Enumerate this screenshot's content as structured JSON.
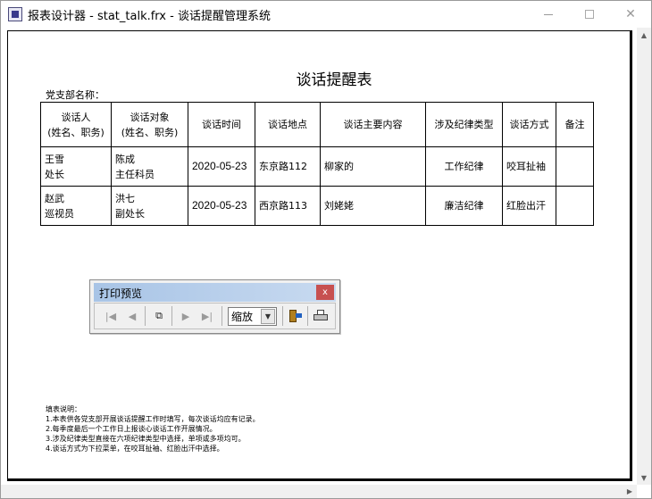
{
  "window": {
    "title": "报表设计器 - stat_talk.frx - 谈话提醒管理系统",
    "minimize_glyph": "—",
    "maximize_glyph": "☐",
    "close_glyph": "✕"
  },
  "report": {
    "title": "谈话提醒表",
    "branch_label": "党支部名称：",
    "headers": {
      "talker_line1": "谈话人",
      "talker_line2": "(姓名、职务)",
      "target_line1": "谈话对象",
      "target_line2": "(姓名、职务)",
      "time": "谈话时间",
      "place": "谈话地点",
      "content": "谈话主要内容",
      "discipline": "涉及纪律类型",
      "method": "谈话方式",
      "remark": "备注"
    },
    "rows": [
      {
        "talker_name": "王雪",
        "talker_title": "处长",
        "target_name": "陈成",
        "target_title": "主任科员",
        "time": "2020-05-23",
        "place": "东京路112",
        "content": "柳家的",
        "discipline": "工作纪律",
        "method": "咬耳扯袖",
        "remark": ""
      },
      {
        "talker_name": "赵武",
        "talker_title": "巡视员",
        "target_name": "洪七",
        "target_title": "副处长",
        "time": "2020-05-23",
        "place": "西京路113",
        "content": "刘姥姥",
        "discipline": "廉洁纪律",
        "method": "红脸出汗",
        "remark": ""
      }
    ],
    "notes": [
      "填表说明：",
      "1.本表供各党支部开展谈话提醒工作时填写，每次谈话均应有记录。",
      "2.每季度最后一个工作日上报谈心谈话工作开展情况。",
      "3.涉及纪律类型直接在六项纪律类型中选择，单项或多项均可。",
      "4.谈话方式为下拉菜单，在咬耳扯袖、红脸出汗中选择。"
    ]
  },
  "toolbar": {
    "title": "打印预览",
    "close_glyph": "x",
    "zoom_value": "缩放",
    "icons": {
      "first": "first-page-icon",
      "prev": "previous-page-icon",
      "copy": "multi-page-icon",
      "next": "next-page-icon",
      "last": "last-page-icon",
      "exit": "exit-icon",
      "print": "print-icon"
    },
    "glyphs": {
      "first": "|◀",
      "prev": "◀",
      "copy": "⧉",
      "next": "▶",
      "last": "▶|",
      "dropdown": "▼"
    }
  },
  "colors": {
    "toolbar_title_bg": "#a8c4e6",
    "toolbar_close_bg": "#c75050"
  }
}
